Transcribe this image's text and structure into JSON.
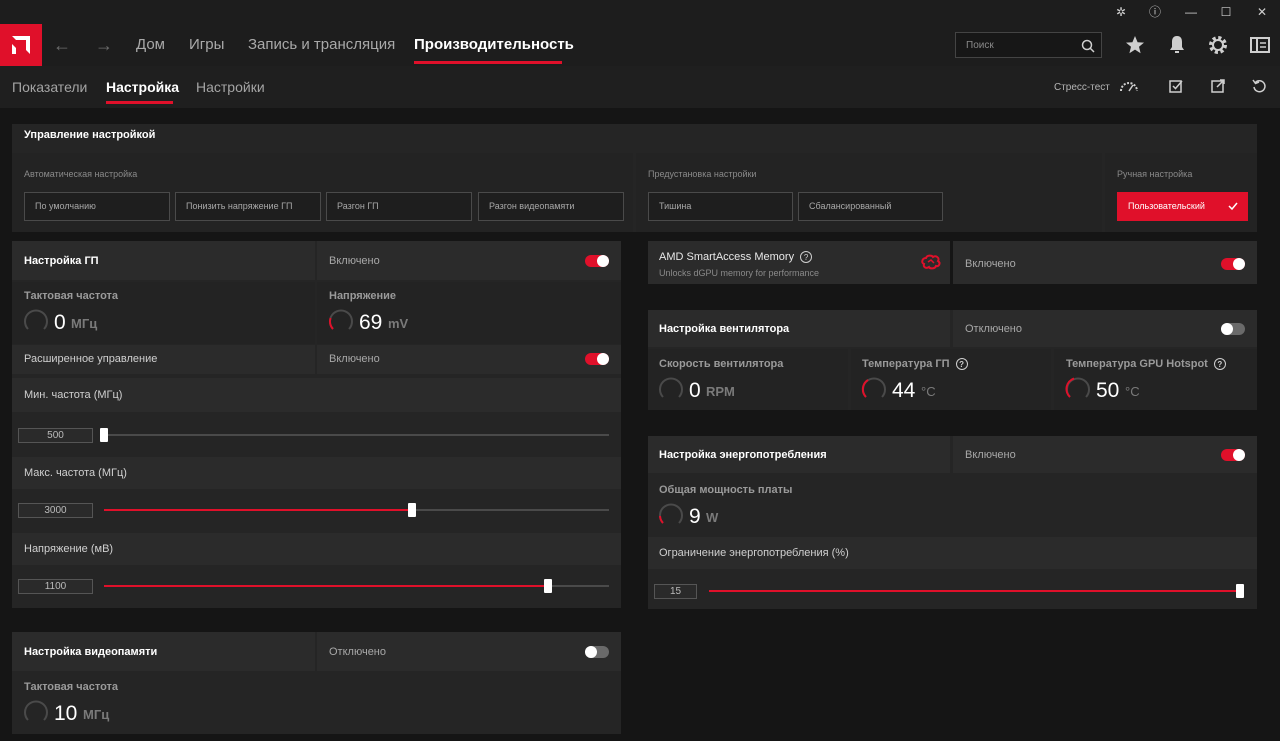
{
  "nav": {
    "items": [
      "Дом",
      "Игры",
      "Запись и трансляция",
      "Производительность"
    ],
    "search_placeholder": "Поиск"
  },
  "subtabs": [
    "Показатели",
    "Настройка",
    "Настройки"
  ],
  "subbar": {
    "stress_test": "Стресс-тест"
  },
  "tuning_control": {
    "title": "Управление настройкой",
    "auto": {
      "label": "Автоматическая настройка",
      "buttons": [
        "По умолчанию",
        "Понизить напряжение ГП",
        "Разгон ГП",
        "Разгон видеопамяти"
      ]
    },
    "preset": {
      "label": "Предустановка настройки",
      "buttons": [
        "Тишина",
        "Сбалансированный"
      ]
    },
    "manual": {
      "label": "Ручная настройка",
      "button": "Пользовательский"
    }
  },
  "gpu_tuning": {
    "title": "Настройка ГП",
    "state": "Включено",
    "enabled": true,
    "clock": {
      "label": "Тактовая частота",
      "value": "0",
      "unit": "МГц"
    },
    "voltage": {
      "label": "Напряжение",
      "value": "69",
      "unit": "mV"
    },
    "advanced": {
      "label": "Расширенное управление",
      "state": "Включено",
      "enabled": true
    },
    "min_freq": {
      "label": "Мин. частота (МГц)",
      "value": "500",
      "fraction": 0.0
    },
    "max_freq": {
      "label": "Макс. частота (МГц)",
      "value": "3000",
      "fraction": 0.55
    },
    "voltage_mv": {
      "label": "Напряжение (мВ)",
      "value": "1100",
      "fraction": 0.88
    }
  },
  "vram_tuning": {
    "title": "Настройка видеопамяти",
    "state": "Отключено",
    "enabled": false,
    "clock": {
      "label": "Тактовая частота",
      "value": "10",
      "unit": "МГц"
    }
  },
  "sam": {
    "title": "AMD SmartAccess Memory",
    "subtitle": "Unlocks dGPU memory for performance",
    "state": "Включено",
    "enabled": true
  },
  "fan_tuning": {
    "title": "Настройка вентилятора",
    "state": "Отключено",
    "enabled": false,
    "fan_speed": {
      "label": "Скорость вентилятора",
      "value": "0",
      "unit": "RPM"
    },
    "gpu_temp": {
      "label": "Температура ГП",
      "value": "44",
      "unit": "°C"
    },
    "hotspot_temp": {
      "label": "Температура GPU Hotspot",
      "value": "50",
      "unit": "°C"
    }
  },
  "power_tuning": {
    "title": "Настройка энергопотребления",
    "state": "Включено",
    "enabled": true,
    "board_power": {
      "label": "Общая мощность платы",
      "value": "9",
      "unit": "W"
    },
    "power_limit": {
      "label": "Ограничение энергопотребления (%)",
      "value": "15",
      "fraction": 1.0
    }
  },
  "colors": {
    "accent": "#e0102a",
    "background": "#151515",
    "panel": "#252525"
  },
  "icons": [
    "amd-logo-icon",
    "back-arrow-icon",
    "forward-arrow-icon",
    "search-icon",
    "star-icon",
    "bell-icon",
    "gear-icon",
    "sidebar-icon",
    "bug-icon",
    "help-icon",
    "minimize-icon",
    "maximize-icon",
    "close-icon",
    "stress-test-gauge-icon",
    "export-check-icon",
    "share-icon",
    "reset-icon",
    "checkmark-icon",
    "brain-icon"
  ]
}
